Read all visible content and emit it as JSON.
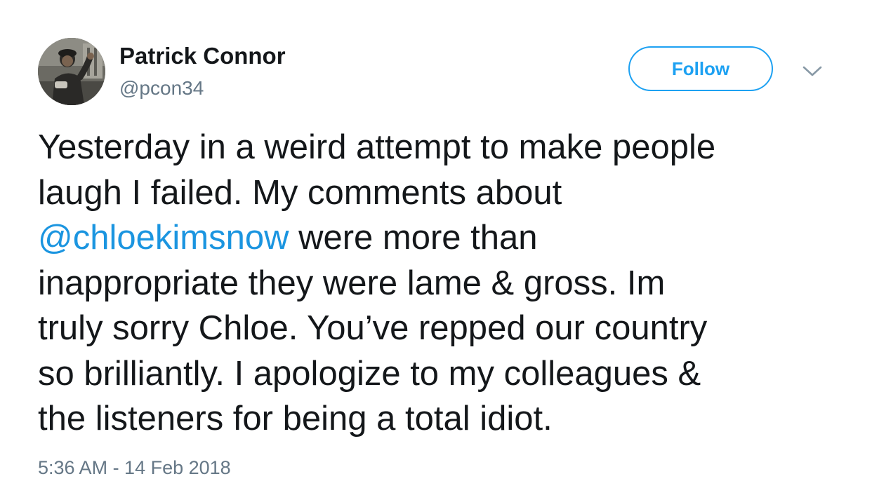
{
  "author": {
    "display_name": "Patrick Connor",
    "handle": "@pcon34"
  },
  "follow_button": {
    "label": "Follow"
  },
  "tweet": {
    "text_line_1": "Yesterday in a weird attempt to make people",
    "text_line_2": "laugh I failed. My comments about",
    "mention": "@chloekimsnow",
    "text_after_mention": " were more than",
    "text_line_4": "inappropriate they were lame & gross. Im",
    "text_line_5": "truly sorry Chloe. You’ve repped our country",
    "text_line_6": "so brilliantly. I apologize to my colleagues &",
    "text_line_7": "the listeners for being a total idiot.",
    "timestamp": "5:36 AM - 14 Feb 2018"
  },
  "icons": {
    "avatar": "profile-photo",
    "caret": "chevron-down-icon"
  },
  "colors": {
    "accent": "#1da1f2",
    "mention": "#1b95e0",
    "text": "#14171a",
    "secondary": "#657786",
    "caret": "#8899a6"
  }
}
